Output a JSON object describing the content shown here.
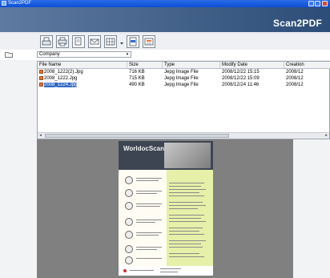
{
  "window": {
    "title": "Scan2PDF"
  },
  "header": {
    "logo": "Scan2PDF"
  },
  "folder": {
    "selected": "Company"
  },
  "file_list": {
    "columns": [
      "File Name",
      "Size",
      "Type",
      "Modify Date",
      "Creation"
    ],
    "rows": [
      {
        "name": "2008_1222(2).Jpg",
        "size": "716 KB",
        "type": "Jepg Image File",
        "modified": "2008/12/22 15:15",
        "created": "2008/12"
      },
      {
        "name": "2008_1222.Jpg",
        "size": "715 KB",
        "type": "Jepg Image File",
        "modified": "2008/12/22 15:09",
        "created": "2008/12"
      },
      {
        "name": "2008_1224.Jpg",
        "size": "490 KB",
        "type": "Jepg Image File",
        "modified": "2008/12/24 11:46",
        "created": "2008/12",
        "selected": true
      }
    ]
  },
  "preview": {
    "brand": "WorldocScan"
  },
  "icons": [
    "app-icon",
    "scan-icon",
    "print-icon",
    "copy-icon",
    "mail-icon",
    "grid-icon",
    "pdf-icon",
    "export-icon",
    "folder-icon"
  ]
}
